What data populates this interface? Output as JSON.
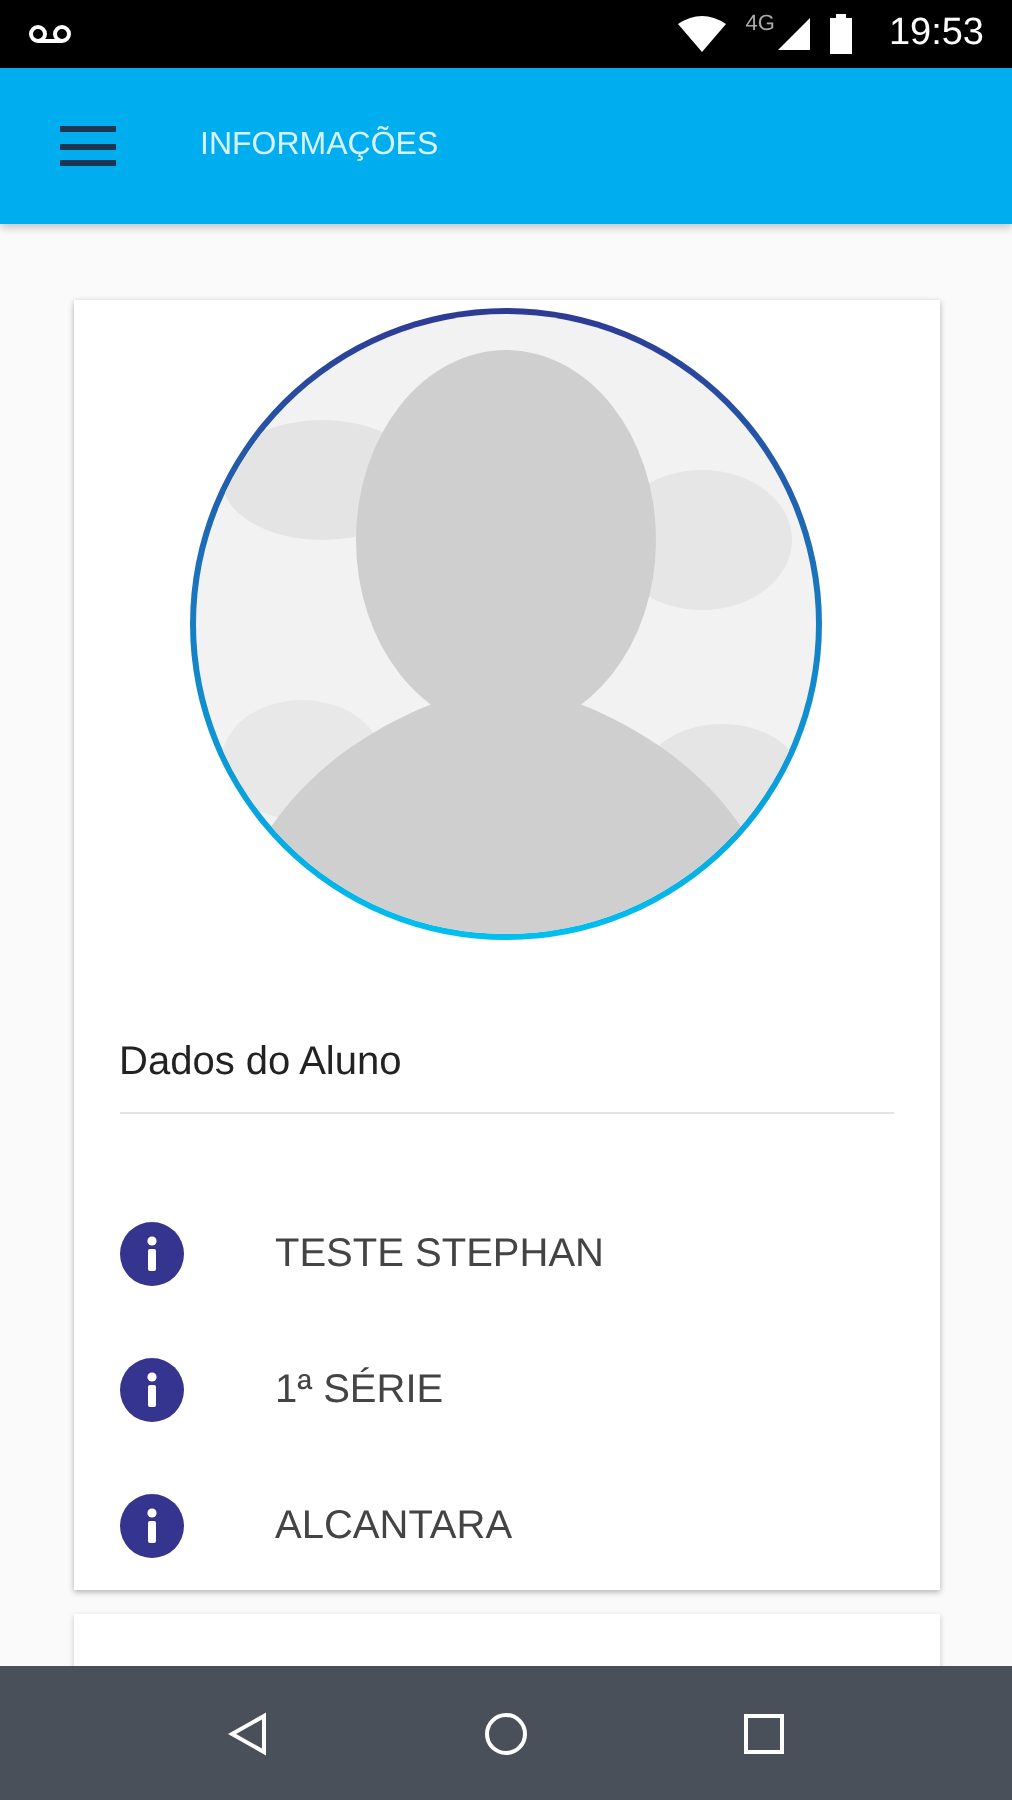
{
  "status_bar": {
    "network": "4G",
    "time": "19:53"
  },
  "app_bar": {
    "title": "INFORMAÇÕES"
  },
  "student": {
    "section_title": "Dados do Aluno",
    "rows": [
      {
        "text": "TESTE STEPHAN"
      },
      {
        "text": "1ª SÉRIE"
      },
      {
        "text": "ALCANTARA"
      }
    ]
  }
}
